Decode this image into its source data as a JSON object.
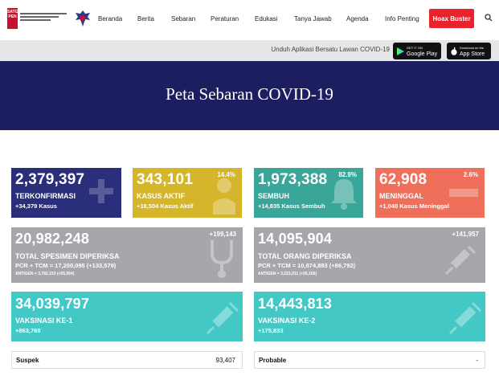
{
  "nav": {
    "logo_text": "SATGAS PEN",
    "items": [
      "Beranda",
      "Berita",
      "Sebaran",
      "Peraturan",
      "Edukasi",
      "Tanya Jawab",
      "Agenda",
      "Info Penting"
    ],
    "hoax_button": "Hoax Buster",
    "search_icon": "search-icon"
  },
  "appbar": {
    "label": "Unduh Aplikasi Bersatu Lawan COVID-19",
    "google_small": "GET IT ON",
    "google_big": "Google Play",
    "apple_small": "Download on the",
    "apple_big": "App Store"
  },
  "hero": {
    "title": "Peta Sebaran COVID-19"
  },
  "cards": {
    "terkonfirmasi": {
      "value": "2,379,397",
      "label": "TERKONFIRMASI",
      "delta": "+34,379 Kasus",
      "color": "#2b2e7a"
    },
    "aktif": {
      "value": "343,101",
      "label": "KASUS AKTIF",
      "delta": "+18,504 Kasus Aktif",
      "pct": "14.4%",
      "color": "#d5b52a"
    },
    "sembuh": {
      "value": "1,973,388",
      "label": "SEMBUH",
      "delta": "+14,835 Kasus Sembuh",
      "pct": "82.9%",
      "color": "#3aa69a"
    },
    "meninggal": {
      "value": "62,908",
      "label": "MENINGGAL",
      "delta": "+1,040 Kasus Meninggal",
      "pct": "2.6%",
      "color": "#f06f5b"
    },
    "spesimen": {
      "value": "20,982,248",
      "label": "TOTAL SPESIMEN DIPERIKSA",
      "delta": "+199,143",
      "pcr": "PCR + TCM = 17,200,095 (+133,579)",
      "antigen": "ANTIGEN = 3,782,153 (+65,564)"
    },
    "orang": {
      "value": "14,095,904",
      "label": "TOTAL ORANG DIPERIKSA",
      "delta": "+141,957",
      "pcr": "PCR + TCM = 10,874,893 (+86,792)",
      "antigen": "ANTIGEN = 3,221,011 (+55,165)"
    },
    "vaksin1": {
      "value": "34,039,797",
      "label": "VAKSINASI KE-1",
      "delta": "+863,768"
    },
    "vaksin2": {
      "value": "14,443,813",
      "label": "VAKSINASI KE-2",
      "delta": "+175,833"
    }
  },
  "footer": {
    "suspek_label": "Suspek",
    "suspek_value": "93,407",
    "probable_label": "Probable",
    "probable_value": "-"
  }
}
